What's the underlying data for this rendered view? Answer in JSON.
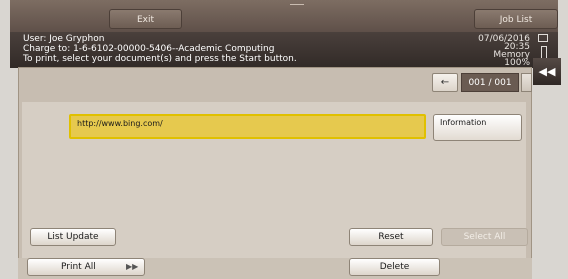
{
  "topbar": {
    "exit_label": "Exit",
    "job_list_label": "Job List"
  },
  "status": {
    "user_line": "User: Joe Gryphon",
    "charge_line": "Charge to: 1-6-6102-00000-5406--Academic Computing",
    "instruction_line": "To print, select your document(s) and press the Start button.",
    "date": "07/06/2016",
    "time": "20:35",
    "memory_label": "Memory",
    "memory_value": "100%"
  },
  "pager": {
    "page_indicator": "001 / 001"
  },
  "documents": [
    {
      "name": "http://www.bing.com/"
    }
  ],
  "buttons": {
    "information": "Information",
    "list_update": "List Update",
    "reset": "Reset",
    "select_all": "Select All",
    "print_all": "Print All",
    "delete": "Delete"
  },
  "icons": {
    "back": "double-left-arrow-icon",
    "prev": "left-arrow-icon",
    "print_all_arrow": "double-right-arrow-icon"
  }
}
